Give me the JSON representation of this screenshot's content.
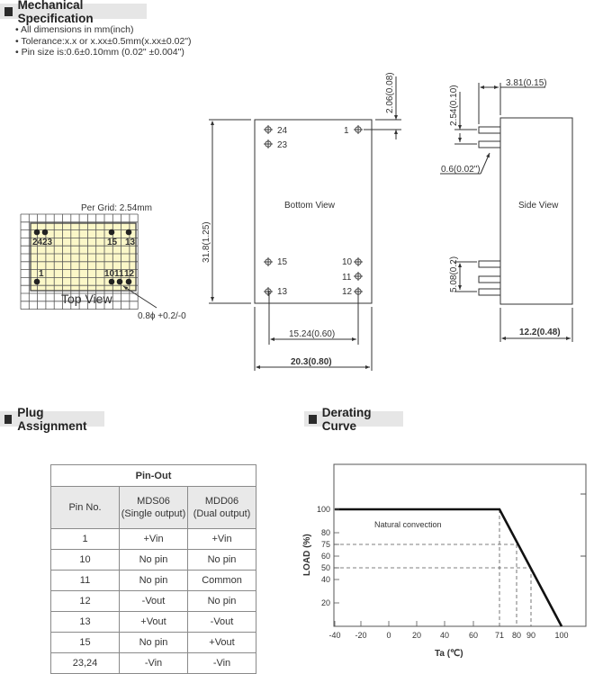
{
  "sections": {
    "mechanical": "Mechanical Specification",
    "plug": "Plug Assignment",
    "derating": "Derating Curve"
  },
  "bullets": [
    "All dimensions in mm(inch)",
    "Tolerance:x.x  or  x.xx±0.5mm(x.xx±0.02\")",
    "Pin size is:0.6±0.10mm (0.02\" ±0.004\")"
  ],
  "top_view": {
    "grid_label": "Per Grid: 2.54mm",
    "title": "Top  View",
    "hole_note": "0.8ϕ +0.2/-0",
    "pins": {
      "p24": "24",
      "p23": "23",
      "p15": "15",
      "p13": "13",
      "p1": "1",
      "p10": "10",
      "p11": "11",
      "p12": "12"
    },
    "fill_color": "#fbf7c8"
  },
  "bottom_view": {
    "title": "Bottom  View",
    "pins": {
      "p24": "24",
      "p23": "23",
      "p1": "1",
      "p15": "15",
      "p13": "13",
      "p10": "10",
      "p11": "11",
      "p12": "12"
    },
    "dim_height": "31.8(1.25)",
    "dim_top": "2.06(0.08)",
    "dim_pitch": "15.24(0.60)",
    "dim_width": "20.3(0.80)"
  },
  "side_view": {
    "title": "Side  View",
    "dim_pin_len": "3.81(0.15)",
    "dim_pin_pitch": "2.54(0.10)",
    "dim_pin_dia": "0.6(0.02\")",
    "dim_pin_span": "5.08(0.2)",
    "dim_depth": "12.2(0.48)"
  },
  "pinout": {
    "title": "Pin-Out",
    "headers": [
      "Pin No.",
      "MDS06",
      "(Single output)",
      "MDD06",
      "(Dual output)"
    ],
    "rows": [
      [
        "1",
        "+Vin",
        "+Vin"
      ],
      [
        "10",
        "No pin",
        "No pin"
      ],
      [
        "11",
        "No pin",
        "Common"
      ],
      [
        "12",
        "-Vout",
        "No pin"
      ],
      [
        "13",
        "+Vout",
        "-Vout"
      ],
      [
        "15",
        "No pin",
        "+Vout"
      ],
      [
        "23,24",
        "-Vin",
        "-Vin"
      ]
    ]
  },
  "chart_data": {
    "type": "line",
    "title": "Derating Curve",
    "xlabel": "Ta (℃)",
    "ylabel": "LOAD (%)",
    "annotation": "Natural convection",
    "x_ticks": [
      -40,
      -20,
      0,
      20,
      40,
      60,
      71,
      80,
      90,
      100
    ],
    "y_ticks": [
      100,
      80,
      75,
      60,
      50,
      40,
      20
    ],
    "series": [
      {
        "name": "Natural convection",
        "points": [
          [
            -40,
            100
          ],
          [
            71,
            100
          ],
          [
            100,
            0
          ]
        ]
      }
    ],
    "reference_lines": {
      "vertical": [
        [
          71,
          100
        ],
        [
          80,
          75
        ],
        [
          90,
          50
        ]
      ],
      "horizontal": [
        [
          75,
          80
        ],
        [
          50,
          90
        ]
      ]
    },
    "grid": false,
    "xlim": [
      -40,
      110
    ],
    "ylim": [
      0,
      130
    ]
  }
}
